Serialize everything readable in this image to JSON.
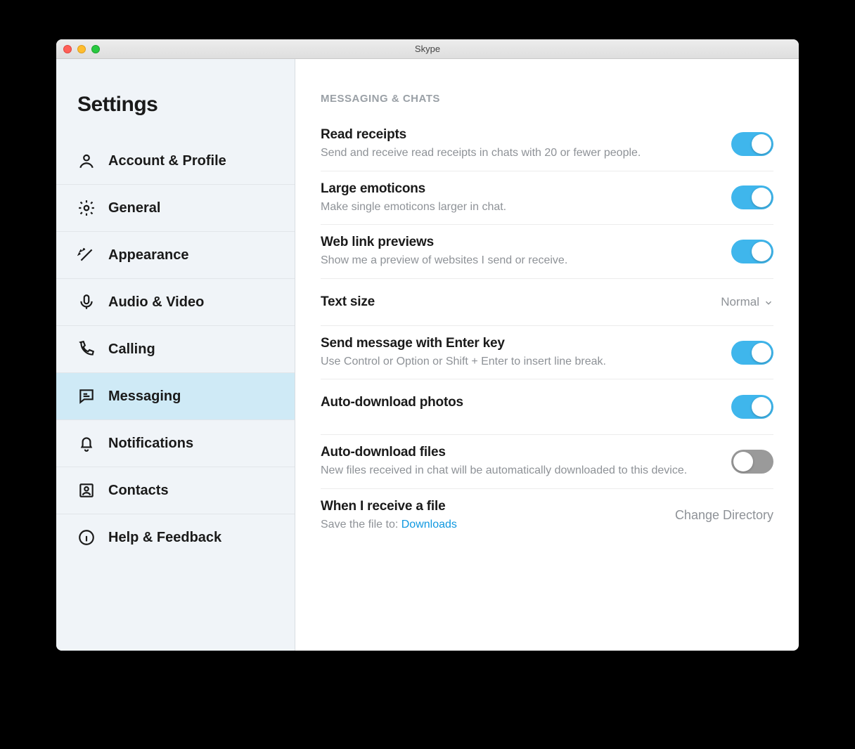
{
  "window": {
    "title": "Skype"
  },
  "sidebar": {
    "title": "Settings",
    "items": [
      {
        "id": "account",
        "label": "Account & Profile"
      },
      {
        "id": "general",
        "label": "General"
      },
      {
        "id": "appearance",
        "label": "Appearance"
      },
      {
        "id": "audiovideo",
        "label": "Audio & Video"
      },
      {
        "id": "calling",
        "label": "Calling"
      },
      {
        "id": "messaging",
        "label": "Messaging"
      },
      {
        "id": "notifications",
        "label": "Notifications"
      },
      {
        "id": "contacts",
        "label": "Contacts"
      },
      {
        "id": "help",
        "label": "Help & Feedback"
      }
    ],
    "active": "messaging"
  },
  "main": {
    "sectionHeader": "MESSAGING & CHATS",
    "rows": {
      "readReceipts": {
        "title": "Read receipts",
        "desc": "Send and receive read receipts in chats with 20 or fewer people.",
        "on": true
      },
      "largeEmoticons": {
        "title": "Large emoticons",
        "desc": "Make single emoticons larger in chat.",
        "on": true
      },
      "webLinkPreviews": {
        "title": "Web link previews",
        "desc": "Show me a preview of websites I send or receive.",
        "on": true
      },
      "textSize": {
        "title": "Text size",
        "value": "Normal"
      },
      "sendEnter": {
        "title": "Send message with Enter key",
        "desc": "Use Control or Option or Shift + Enter to insert line break.",
        "on": true
      },
      "autoPhotos": {
        "title": "Auto-download photos",
        "on": true
      },
      "autoFiles": {
        "title": "Auto-download files",
        "desc": "New files received in chat will be automatically downloaded to this device.",
        "on": false
      },
      "receiveFile": {
        "title": "When I receive a file",
        "descPrefix": "Save the file to: ",
        "descLink": "Downloads",
        "action": "Change Directory"
      }
    }
  }
}
